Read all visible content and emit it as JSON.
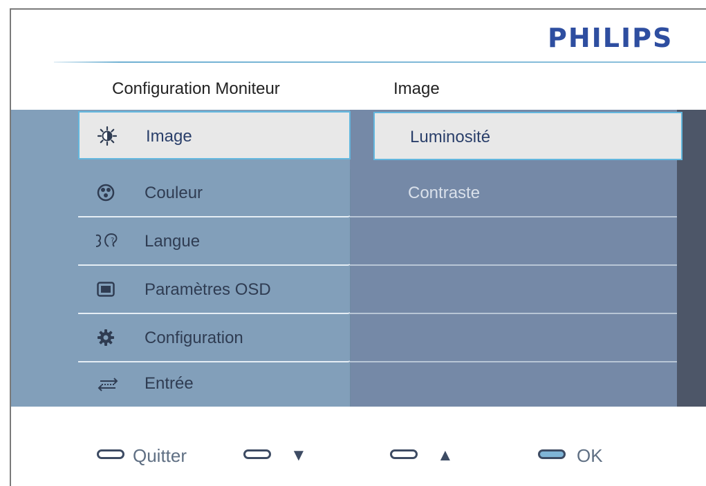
{
  "brand": {
    "logo_text": "PHILIPS",
    "color": "#2e4ea0"
  },
  "header": {
    "left_title": "Configuration Moniteur",
    "right_title": "Image"
  },
  "left_menu": [
    {
      "label": "Image",
      "icon": "brightness-icon",
      "selected": true
    },
    {
      "label": "Couleur",
      "icon": "color-palette-icon",
      "selected": false
    },
    {
      "label": "Langue",
      "icon": "language-icon",
      "selected": false
    },
    {
      "label": "Paramètres OSD",
      "icon": "osd-screen-icon",
      "selected": false
    },
    {
      "label": "Configuration",
      "icon": "gear-icon",
      "selected": false
    },
    {
      "label": "Entrée",
      "icon": "input-arrows-icon",
      "selected": false
    }
  ],
  "right_menu": [
    {
      "label": "Luminosité",
      "selected": true
    },
    {
      "label": "Contraste",
      "selected": false
    },
    {
      "label": "",
      "selected": false
    },
    {
      "label": "",
      "selected": false
    },
    {
      "label": "",
      "selected": false
    }
  ],
  "footer": {
    "quit_label": "Quitter",
    "down_glyph": "▼",
    "up_glyph": "▲",
    "ok_label": "OK"
  },
  "colors": {
    "menu_background": "#829fba",
    "submenu_background": "#7589a7",
    "selection_border": "#63b7de",
    "selection_fill": "#e8e8e8"
  }
}
